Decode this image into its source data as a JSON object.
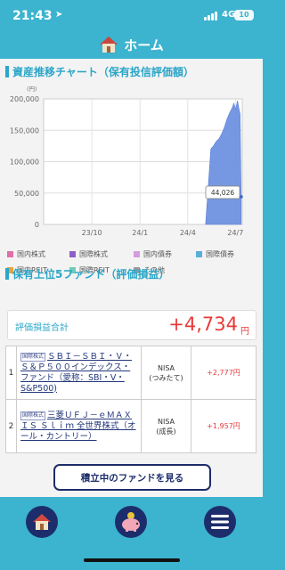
{
  "status_bar": {
    "time": "21:43",
    "network": "4G",
    "battery": "10"
  },
  "header": {
    "title": "ホーム"
  },
  "chart_section": {
    "title": "資産推移チャート（保有投信評価額）"
  },
  "chart_data": {
    "type": "area",
    "title": "資産推移チャート（保有投信評価額）",
    "yunit": "(円)",
    "ylim": [
      0,
      200000
    ],
    "yticks": [
      "200,000",
      "150,000",
      "100,000",
      "50,000",
      "0"
    ],
    "xticks": [
      "23/10",
      "24/1",
      "24/4",
      "24/7"
    ],
    "grid": true,
    "series": [
      {
        "color": "#6a8fe0",
        "x": [
          "24/5/5",
          "24/5/10",
          "24/5/15",
          "24/5/20",
          "24/5/25",
          "24/5/31",
          "24/6/5",
          "24/6/10",
          "24/6/15",
          "24/6/20",
          "24/6/25",
          "24/6/28",
          "24/7/1",
          "24/7/5",
          "24/7/8",
          "24/7/10",
          "24/7/12"
        ],
        "values": [
          0,
          60000,
          120000,
          125000,
          132000,
          137000,
          145000,
          155000,
          168000,
          178000,
          186000,
          193000,
          183000,
          197000,
          183000,
          176000,
          44026
        ]
      }
    ],
    "tooltip": "44,026"
  },
  "legend": [
    {
      "label": "国内株式",
      "color": "#e06fa8"
    },
    {
      "label": "国際株式",
      "color": "#8f5fc7"
    },
    {
      "label": "国内債券",
      "color": "#d49be0"
    },
    {
      "label": "国際債券",
      "color": "#5aaed8"
    },
    {
      "label": "国内REIT",
      "color": "#e9a23c"
    },
    {
      "label": "国際REIT",
      "color": "#6ccdb6"
    },
    {
      "label": "その他",
      "color": "#9a9a9a"
    }
  ],
  "funds_section": {
    "title": "保有上位5ファンド（評価損益）"
  },
  "total": {
    "label": "評価損益合計",
    "value": "+4,734",
    "unit": "円"
  },
  "funds": [
    {
      "rank": "1",
      "tag": "国際株式",
      "name": "ＳＢＩ－ＳＢＩ・Ｖ・Ｓ＆Ｐ５００インデックス・ファンド（愛称：SBI・V・S&P500)",
      "account_1": "NISA",
      "account_2": "(つみたて)",
      "pl": "+2,777円"
    },
    {
      "rank": "2",
      "tag": "国際株式",
      "name": "三菱ＵＦＪ－ｅＭＡＸＩＳ Ｓｌｉｍ 全世界株式（オール・カントリー）",
      "account_1": "NISA",
      "account_2": "(成長)",
      "pl": "+1,957円"
    }
  ],
  "actions": {
    "view_funds": "積立中のファンドを見る"
  },
  "nav": [
    "home-icon",
    "piggy-bank-icon",
    "menu-icon"
  ]
}
